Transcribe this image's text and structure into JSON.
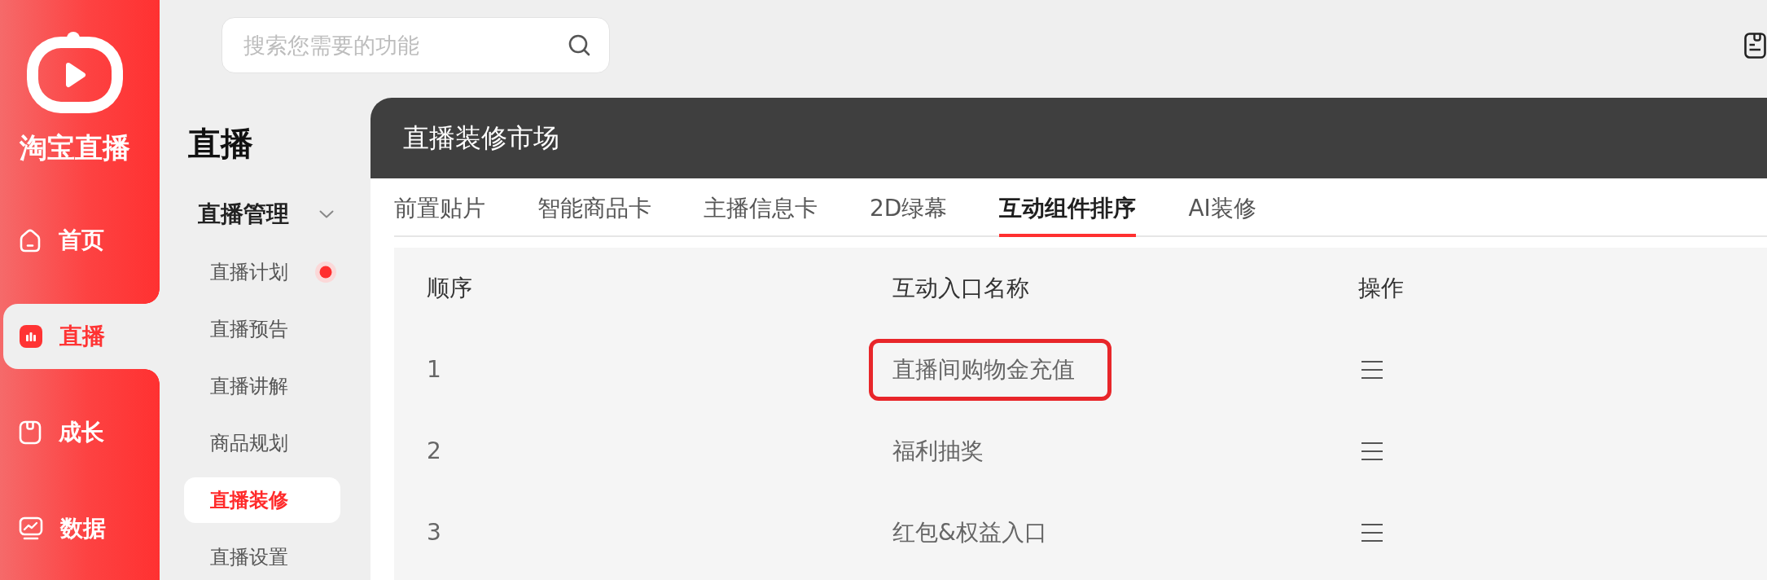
{
  "brand": {
    "name": "淘宝直播"
  },
  "nav": [
    {
      "label": "首页",
      "selected": false
    },
    {
      "label": "直播",
      "selected": true
    },
    {
      "label": "成长",
      "selected": false
    },
    {
      "label": "数据",
      "selected": false
    }
  ],
  "search": {
    "placeholder": "搜索您需要的功能"
  },
  "submenu": {
    "title": "直播",
    "groups": [
      {
        "label": "直播管理",
        "expanded": true,
        "children": [
          {
            "label": "直播计划",
            "selected": false,
            "dot": true
          },
          {
            "label": "直播预告",
            "selected": false,
            "dot": false
          },
          {
            "label": "直播讲解",
            "selected": false,
            "dot": false
          },
          {
            "label": "商品规划",
            "selected": false,
            "dot": false
          },
          {
            "label": "直播装修",
            "selected": true,
            "dot": false
          },
          {
            "label": "直播设置",
            "selected": false,
            "dot": false
          }
        ]
      }
    ]
  },
  "panel": {
    "title": "直播装修市场",
    "tabs": [
      {
        "label": "前置贴片",
        "selected": false
      },
      {
        "label": "智能商品卡",
        "selected": false
      },
      {
        "label": "主播信息卡",
        "selected": false
      },
      {
        "label": "2D绿幕",
        "selected": false
      },
      {
        "label": "互动组件排序",
        "selected": true
      },
      {
        "label": "AI装修",
        "selected": false
      }
    ],
    "table": {
      "columns": [
        "顺序",
        "互动入口名称",
        "操作"
      ],
      "rows": [
        {
          "order": "1",
          "name": "直播间购物金充值",
          "highlighted": true
        },
        {
          "order": "2",
          "name": "福利抽奖",
          "highlighted": false
        },
        {
          "order": "3",
          "name": "红包&权益入口",
          "highlighted": false
        }
      ]
    }
  }
}
